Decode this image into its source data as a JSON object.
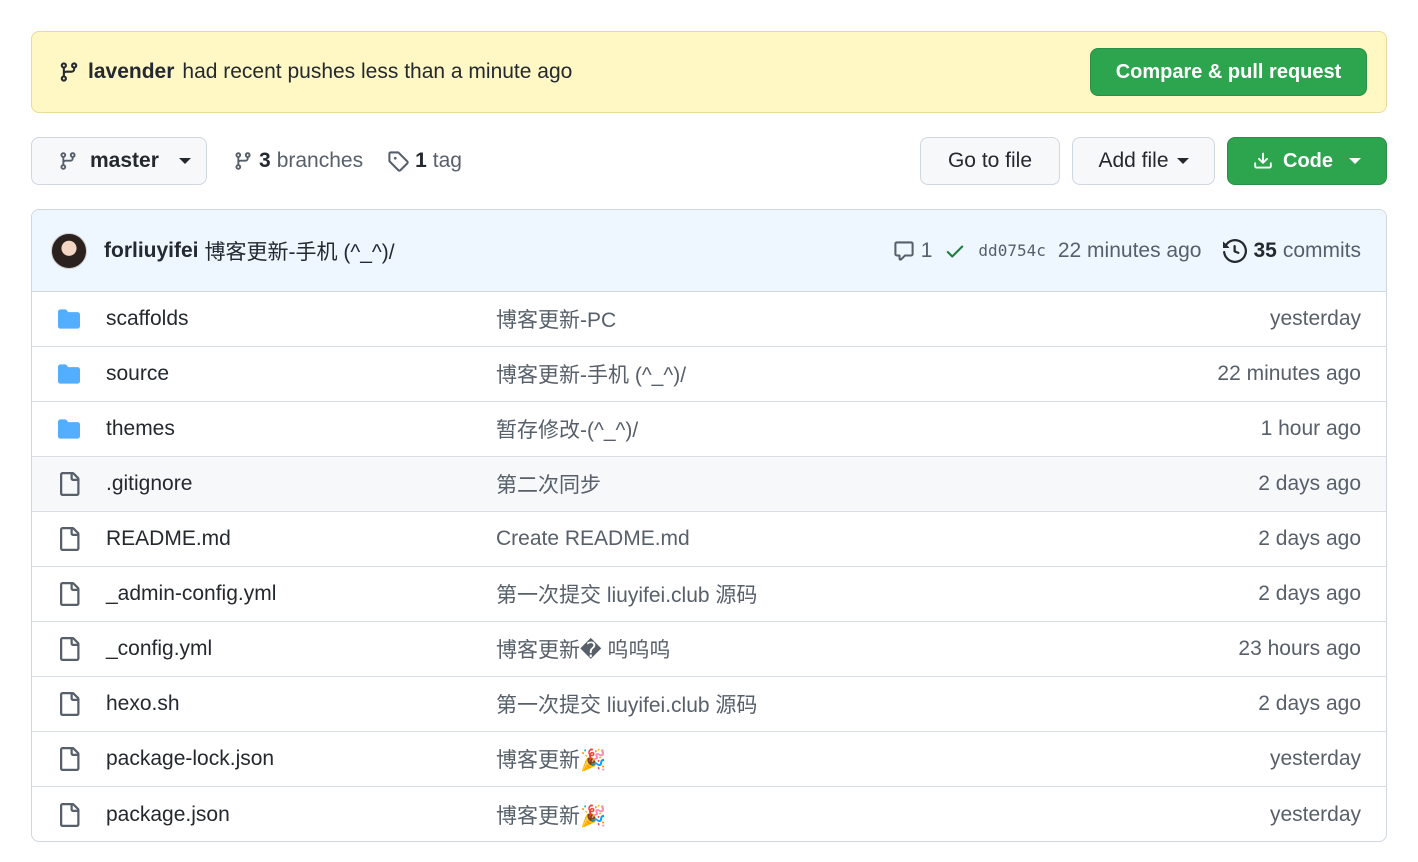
{
  "banner": {
    "branch": "lavender",
    "message": "had recent pushes less than a minute ago",
    "button": "Compare & pull request"
  },
  "toolbar": {
    "branch": "master",
    "branches_count": "3",
    "branches_label": "branches",
    "tags_count": "1",
    "tags_label": "tag",
    "go_to_file": "Go to file",
    "add_file": "Add file",
    "code": "Code"
  },
  "latest_commit": {
    "author": "forliuyifei",
    "message": "博客更新-手机 (^_^)/",
    "comments": "1",
    "sha": "dd0754c",
    "time": "22 minutes ago",
    "commits_count": "35",
    "commits_label": "commits"
  },
  "files": [
    {
      "type": "dir",
      "name": "scaffolds",
      "message": "博客更新-PC",
      "age": "yesterday"
    },
    {
      "type": "dir",
      "name": "source",
      "message": "博客更新-手机 (^_^)/",
      "age": "22 minutes ago"
    },
    {
      "type": "dir",
      "name": "themes",
      "message": "暂存修改-(^_^)/",
      "age": "1 hour ago"
    },
    {
      "type": "file",
      "name": ".gitignore",
      "message": "第二次同步",
      "age": "2 days ago"
    },
    {
      "type": "file",
      "name": "README.md",
      "message": "Create README.md",
      "age": "2 days ago"
    },
    {
      "type": "file",
      "name": "_admin-config.yml",
      "message": "第一次提交 liuyifei.club 源码",
      "age": "2 days ago"
    },
    {
      "type": "file",
      "name": "_config.yml",
      "message": "博客更新� 呜呜呜",
      "age": "23 hours ago"
    },
    {
      "type": "file",
      "name": "hexo.sh",
      "message": "第一次提交 liuyifei.club 源码",
      "age": "2 days ago"
    },
    {
      "type": "file",
      "name": "package-lock.json",
      "message": "博客更新🎉",
      "age": "yesterday"
    },
    {
      "type": "file",
      "name": "package.json",
      "message": "博客更新🎉",
      "age": "yesterday"
    }
  ],
  "colors": {
    "green": "#2da44e",
    "banner_bg": "#fff8c5",
    "commit_bg": "#eef6ff",
    "folder": "#54aeff",
    "check": "#1a7f37"
  }
}
